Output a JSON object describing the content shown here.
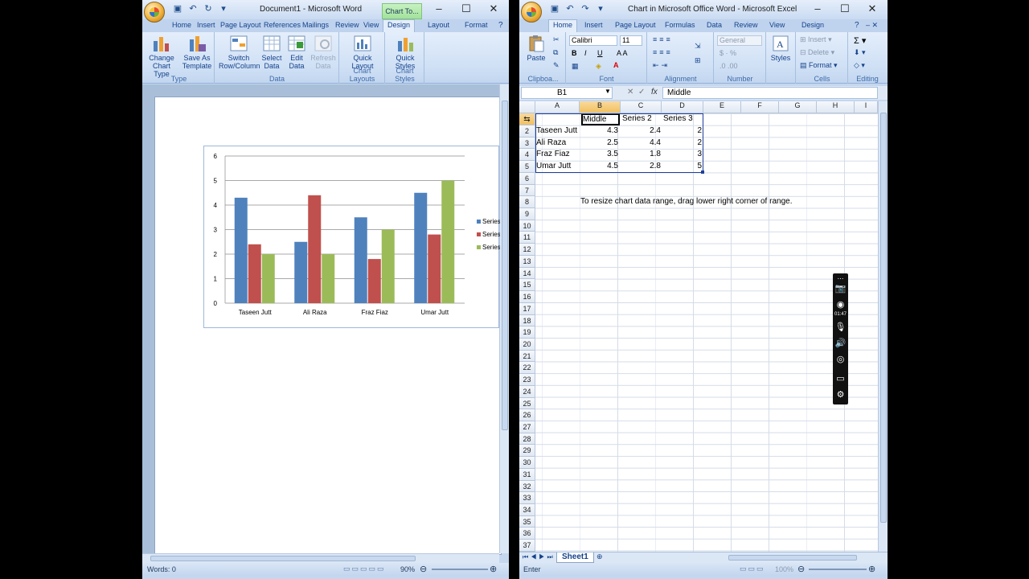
{
  "word": {
    "title": "Document1 - Microsoft Word",
    "context_tab": "Chart To...",
    "tabs": [
      "Home",
      "Insert",
      "Page Layout",
      "References",
      "Mailings",
      "Review",
      "View",
      "Design",
      "Layout",
      "Format"
    ],
    "ribbon": {
      "type_group": {
        "label": "Type",
        "change_chart_type": "Change Chart Type",
        "save_as_template": "Save As Template"
      },
      "data_group": {
        "label": "Data",
        "switch_row_column": "Switch Row/Column",
        "select_data": "Select Data",
        "edit_data": "Edit Data",
        "refresh_data": "Refresh Data"
      },
      "layouts_group": {
        "label": "Chart Layouts",
        "quick_layout": "Quick Layout"
      },
      "styles_group": {
        "label": "Chart Styles",
        "quick_styles": "Quick Styles"
      }
    },
    "status": {
      "words": "Words: 0",
      "zoom": "90%"
    }
  },
  "chart_data": {
    "type": "bar",
    "categories": [
      "Taseen Jutt",
      "Ali Raza",
      "Fraz Fiaz",
      "Umar Jutt"
    ],
    "series": [
      {
        "name": "Series",
        "color": "#4f81bd",
        "values": [
          4.3,
          2.5,
          3.5,
          4.5
        ]
      },
      {
        "name": "Series",
        "color": "#c0504d",
        "values": [
          2.4,
          4.4,
          1.8,
          2.8
        ]
      },
      {
        "name": "Series",
        "color": "#9bbb59",
        "values": [
          2,
          2,
          3,
          5
        ]
      }
    ],
    "yticks": [
      "0",
      "1",
      "2",
      "3",
      "4",
      "5",
      "6"
    ],
    "ylim": [
      0,
      6
    ],
    "grid": true,
    "legend": "right"
  },
  "excel": {
    "title": "Chart in Microsoft Office Word - Microsoft Excel",
    "tabs": [
      "Home",
      "Insert",
      "Page Layout",
      "Formulas",
      "Data",
      "Review",
      "View",
      "Design"
    ],
    "ribbon": {
      "paste": "Paste",
      "font_name": "Calibri",
      "font_size": "11",
      "number_format": "General",
      "styles": "Styles",
      "insert": "Insert",
      "delete": "Delete",
      "format": "Format",
      "groups": [
        "Clipboa...",
        "Font",
        "Alignment",
        "Number",
        "Cells",
        "Editing"
      ]
    },
    "name_box": "B1",
    "formula": "Middle",
    "fx": "fx",
    "columns": [
      "A",
      "B",
      "C",
      "D",
      "E",
      "F",
      "G",
      "H",
      "I"
    ],
    "rows": [
      "2",
      "3",
      "4",
      "5",
      "6",
      "7",
      "8",
      "9",
      "10",
      "11",
      "12",
      "13",
      "14",
      "15",
      "16",
      "17",
      "18",
      "19",
      "20",
      "21",
      "22",
      "23",
      "24",
      "25",
      "26",
      "27",
      "28",
      "29",
      "30",
      "31",
      "32",
      "33",
      "34",
      "35",
      "36",
      "37"
    ],
    "header_row": [
      "",
      "Middle",
      "Series 2",
      "Series 3"
    ],
    "table": [
      [
        "Taseen Jutt",
        "4.3",
        "2.4",
        "2"
      ],
      [
        "Ali Raza",
        "2.5",
        "4.4",
        "2"
      ],
      [
        "Fraz Fiaz",
        "3.5",
        "1.8",
        "3"
      ],
      [
        "Umar Jutt",
        "4.5",
        "2.8",
        "5"
      ]
    ],
    "note": "To resize chart data range, drag lower right corner of range.",
    "sheet_tab": "Sheet1",
    "status": "Enter",
    "zoom": "100%"
  },
  "recorder": {
    "time": "01:47"
  }
}
